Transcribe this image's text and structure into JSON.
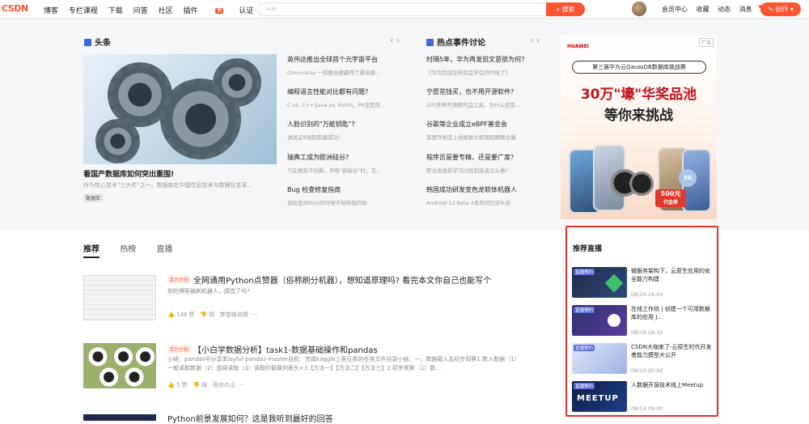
{
  "header": {
    "logo": "CSDN",
    "nav": [
      "博客",
      "专栏课程",
      "下载",
      "问答",
      "社区",
      "插件",
      "认证"
    ],
    "nav_badge": "新",
    "search_placeholder": "vue",
    "search_button": "搜索",
    "right_nav": [
      "会员中心",
      "收藏",
      "动态",
      "消息"
    ],
    "create_button": "创作"
  },
  "headline": {
    "section_title": "头条",
    "main_title": "看国产数据库如何突出重围!",
    "main_desc": "作为核心技术\"三大件\"之一，数据库在中国信息技术与数据化变革...",
    "main_tag": "数据库",
    "items": [
      {
        "title": "英伟达推出全球首个元宇宙平台",
        "desc": "Omniverse 一经推出便赢得了最佳展..."
      },
      {
        "title": "编程语言性能对比都有问题?",
        "desc": "C vs. C++/Java vs. Kotlin，PK还是伤..."
      },
      {
        "title": "人脸识别的\"万能钥匙\"?",
        "desc": "请说这9张脸欺骗成功！"
      },
      {
        "title": "瑞典工成为欧洲硅谷?",
        "desc": "只在根旁不创新，声称\"新硅谷\"时，它..."
      },
      {
        "title": "Bug 检查修复指南",
        "desc": "该给面对BUG的时候不知所措的你"
      }
    ]
  },
  "hot": {
    "section_title": "热点事件讨论",
    "items": [
      {
        "title": "时隔5年，华为再发旧文意欲为何?",
        "desc": "《华为到底在研究会学造的时候了》"
      },
      {
        "title": "宁愿花钱买，也不用开源软件?",
        "desc": "200多种开源替代品工具，为什么还受..."
      },
      {
        "title": "谷歌等企业成立eBPF基金会",
        "desc": "首度开始定上线根据大权限招聘联合量"
      },
      {
        "title": "程序员是要专精，还是要广度?",
        "desc": "职业发展和学习过程到底该怎么做?"
      },
      {
        "title": "韩国成功研发变色龙软体机器人",
        "desc": "Android 12 Beta 4发布同日迎头杀"
      }
    ]
  },
  "ad": {
    "label": "广告",
    "brand": "HUAWEI",
    "pill_text": "第三届华为云GaussDB数据库挑战赛",
    "line1": "30万\"壕\"华奖品池",
    "line2": "等你来挑战",
    "prize": "500元",
    "prize_sub": "代金券",
    "fiveg": "5G"
  },
  "feed_tabs": [
    "推荐",
    "热榜",
    "直播"
  ],
  "articles": [
    {
      "tag": "活力计划",
      "title": "全网通用Python点赞器（俗称刷分机器），想知道原理吗? 看完本文你自己也能写个",
      "desc": "你的博客被刷机器人，感觉了吗?",
      "meta": [
        "148 赞",
        "踩",
        "梦想橡皮擦",
        "···"
      ]
    },
    {
      "tag": "活力计划",
      "title": "【小白学数据分析】task1-数据基础操作和pandas",
      "desc": "小结：pandas中分享率joyful-pandas-master目标：完成kaggle上表征类的任务文件目录小结：一、数据载入及初步观察1.数入数据（1）一般读取数据（2）连续读取（3）读取时替换列表头×3【方法一】【方法二】【方法三】2.初步观察（1）数...",
      "meta": [
        "5 赞",
        "踩",
        "奇妙の山",
        "···"
      ]
    },
    {
      "tag": "",
      "title": "Python前景发展如何？这是我听到最好的回答",
      "desc": "",
      "meta": []
    }
  ],
  "live": {
    "title": "推荐直播",
    "badge": "直播预约",
    "items": [
      {
        "title": "微服务架构下，云原生应用的安全能力构建",
        "time": "08/24 14:00"
      },
      {
        "title": "在线工作坊 | 创建一个可用数据库的应用 J...",
        "time": "08/18 19:30"
      },
      {
        "title": "CSDN大咖来了-云原生时代开发者能力模型大公开",
        "time": "08/19 20:00"
      },
      {
        "title": "人数据开源技术线上Meetup",
        "time": "08/14 09:00"
      }
    ],
    "meetup_text": "MEETUP"
  },
  "colors": {
    "accent": "#fc5531",
    "live_border": "#e5302b",
    "link_blue": "#3b6ad6"
  }
}
